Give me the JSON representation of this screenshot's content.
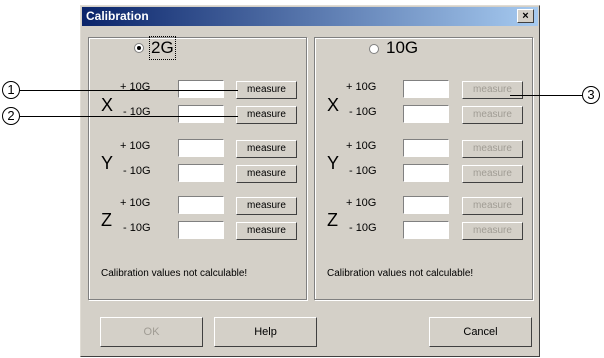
{
  "window": {
    "title": "Calibration",
    "close": "×"
  },
  "left": {
    "mode_label": "2G",
    "mode_selected": true,
    "axes": [
      {
        "axis": "X",
        "plus": "+ 10G",
        "minus": "- 10G",
        "plus_button": "measure",
        "minus_button": "measure"
      },
      {
        "axis": "Y",
        "plus": "+ 10G",
        "minus": "- 10G",
        "plus_button": "measure",
        "minus_button": "measure"
      },
      {
        "axis": "Z",
        "plus": "+ 10G",
        "minus": "- 10G",
        "plus_button": "measure",
        "minus_button": "measure"
      }
    ],
    "status": "Calibration values not calculable!"
  },
  "right": {
    "mode_label": "10G",
    "mode_selected": false,
    "axes": [
      {
        "axis": "X",
        "plus": "+ 10G",
        "minus": "- 10G",
        "plus_button": "measure",
        "minus_button": "measure"
      },
      {
        "axis": "Y",
        "plus": "+ 10G",
        "minus": "- 10G",
        "plus_button": "measure",
        "minus_button": "measure"
      },
      {
        "axis": "Z",
        "plus": "+ 10G",
        "minus": "- 10G",
        "plus_button": "measure",
        "minus_button": "measure"
      }
    ],
    "status": "Calibration values not calculable!"
  },
  "buttons": {
    "ok": "OK",
    "help": "Help",
    "cancel": "Cancel"
  },
  "callouts": [
    "1",
    "2",
    "3"
  ]
}
